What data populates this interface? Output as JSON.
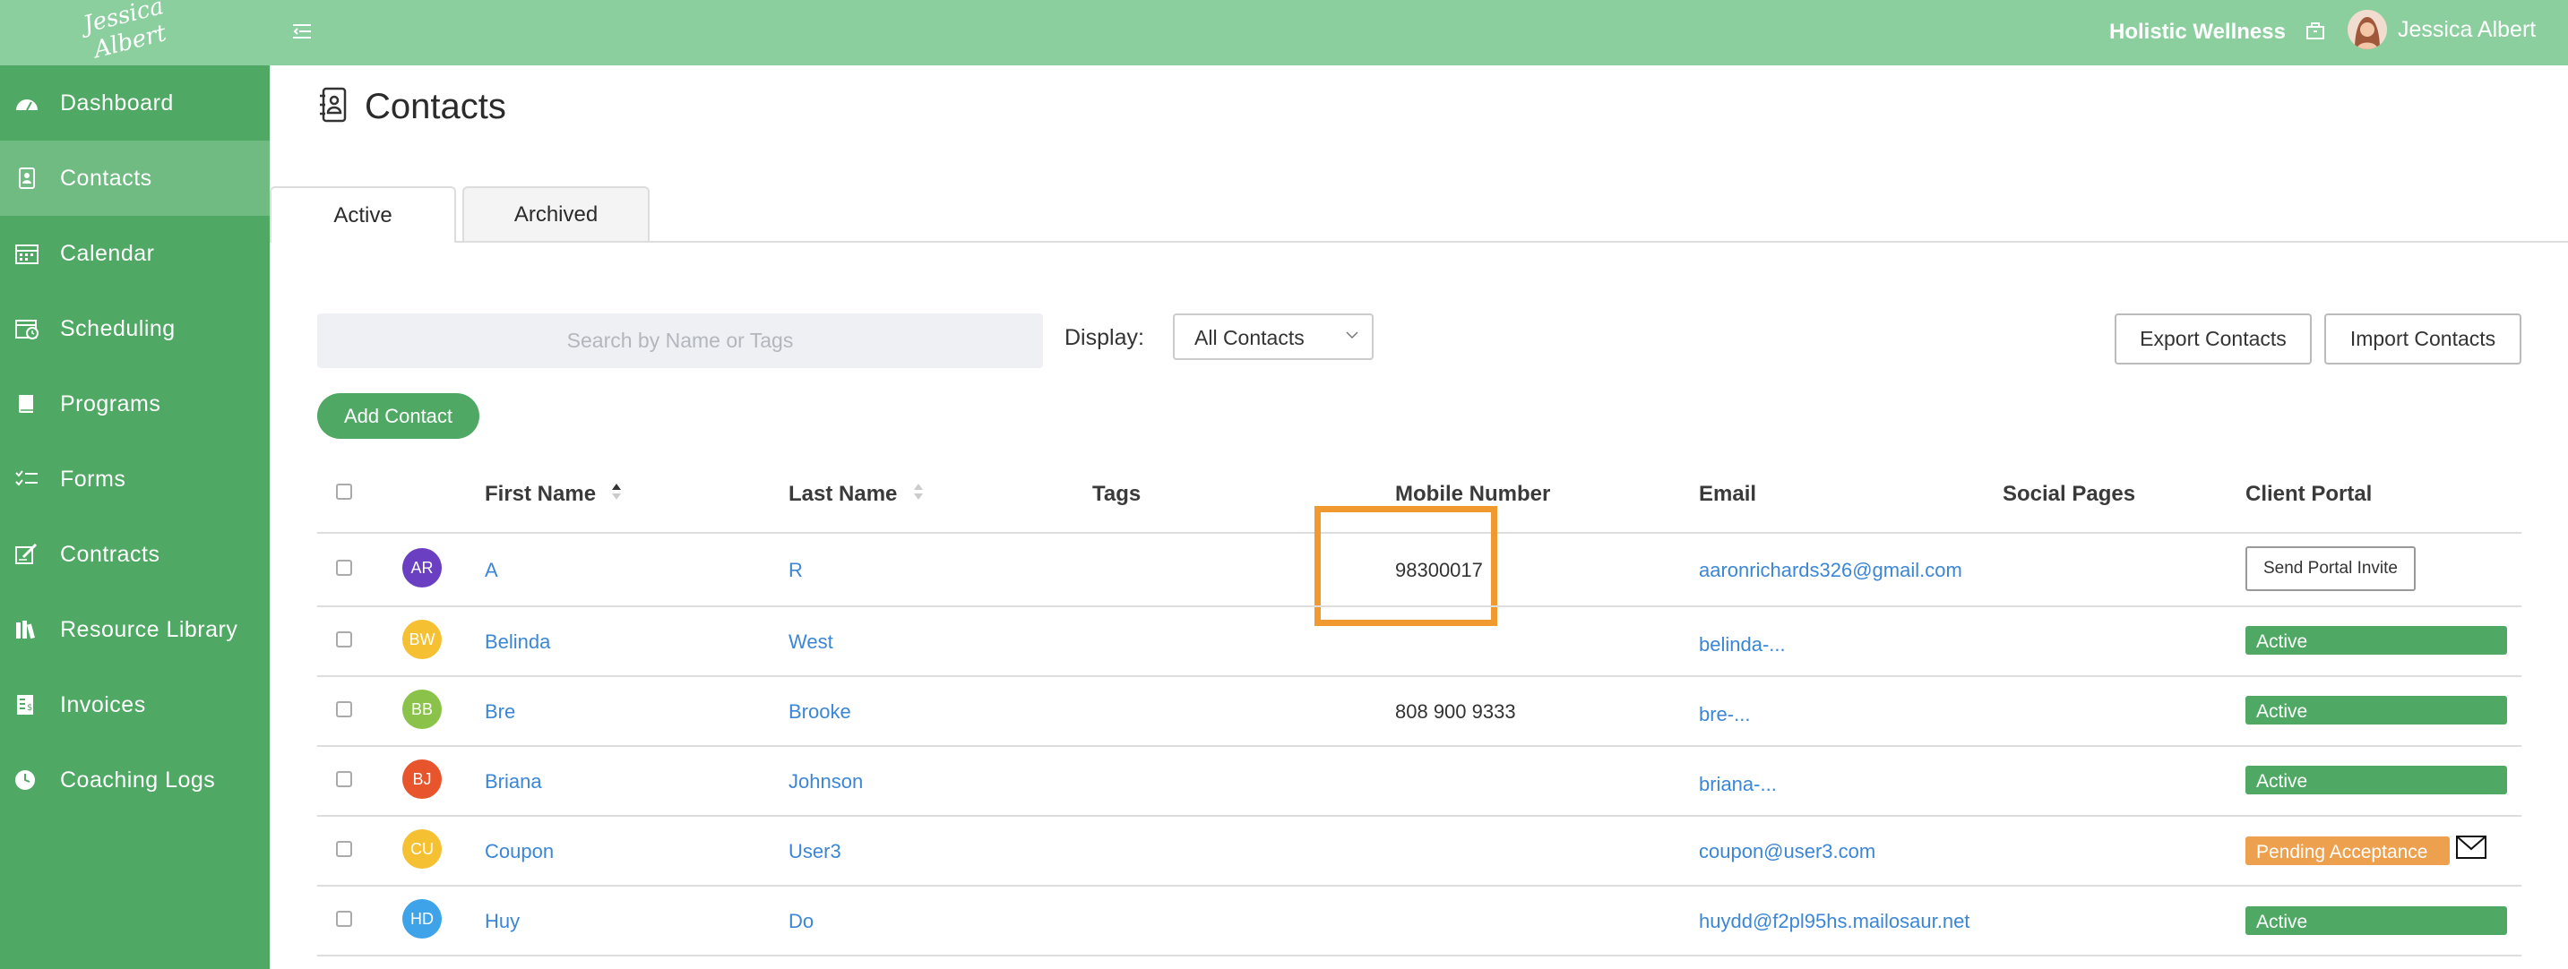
{
  "app": {
    "logo_text": "Jessica Albert",
    "brand_name": "Holistic Wellness",
    "user_name": "Jessica Albert",
    "colors": {
      "topbar": "#8ccf9e",
      "sidebar": "#4fa863",
      "accent": "#4fa863",
      "link": "#3b86d6",
      "pending": "#eda04e",
      "highlight": "#f0992e"
    }
  },
  "sidebar": {
    "items": [
      {
        "label": "Dashboard",
        "icon": "dashboard-icon"
      },
      {
        "label": "Contacts",
        "icon": "contacts-icon",
        "active": true
      },
      {
        "label": "Calendar",
        "icon": "calendar-icon"
      },
      {
        "label": "Scheduling",
        "icon": "scheduling-icon"
      },
      {
        "label": "Programs",
        "icon": "book-icon"
      },
      {
        "label": "Forms",
        "icon": "checklist-icon"
      },
      {
        "label": "Contracts",
        "icon": "signature-icon"
      },
      {
        "label": "Resource Library",
        "icon": "library-icon"
      },
      {
        "label": "Invoices",
        "icon": "invoice-icon"
      },
      {
        "label": "Coaching Logs",
        "icon": "clock-icon"
      }
    ]
  },
  "page": {
    "title": "Contacts",
    "tabs": [
      {
        "label": "Active",
        "active": true
      },
      {
        "label": "Archived"
      }
    ]
  },
  "toolbar": {
    "search_placeholder": "Search by Name or Tags",
    "display_label": "Display:",
    "display_value": "All Contacts",
    "export_label": "Export Contacts",
    "import_label": "Import Contacts",
    "add_contact_label": "Add Contact"
  },
  "table": {
    "headers": [
      "First Name",
      "Last Name",
      "Tags",
      "Mobile Number",
      "Email",
      "Social Pages",
      "Client Portal"
    ],
    "rows": [
      {
        "initials": "AR",
        "avatar_color": "#6a3fc1",
        "first": "A",
        "last": "R",
        "mobile": "98300017",
        "email": "aaronrichards326@gmail.com",
        "portal": "Send Portal Invite",
        "portal_type": "button"
      },
      {
        "initials": "BW",
        "avatar_color": "#f5c132",
        "first": "Belinda",
        "last": "West",
        "mobile": "",
        "email": "belinda-...",
        "portal": "Active",
        "portal_type": "active"
      },
      {
        "initials": "BB",
        "avatar_color": "#8bc34a",
        "first": "Bre",
        "last": "Brooke",
        "mobile": "808 900 9333",
        "email": "bre-...",
        "portal": "Active",
        "portal_type": "active"
      },
      {
        "initials": "BJ",
        "avatar_color": "#e8552c",
        "first": "Briana",
        "last": "Johnson",
        "mobile": "",
        "email": "briana-...",
        "portal": "Active",
        "portal_type": "active"
      },
      {
        "initials": "CU",
        "avatar_color": "#f5c132",
        "first": "Coupon",
        "last": "User3",
        "mobile": "",
        "email": "coupon@user3.com",
        "portal": "Pending Acceptance",
        "portal_type": "pending"
      },
      {
        "initials": "HD",
        "avatar_color": "#3ea3e8",
        "first": "Huy",
        "last": "Do",
        "mobile": "",
        "email": "huydd@f2pl95hs.mailosaur.net",
        "portal": "Active",
        "portal_type": "active"
      }
    ]
  }
}
